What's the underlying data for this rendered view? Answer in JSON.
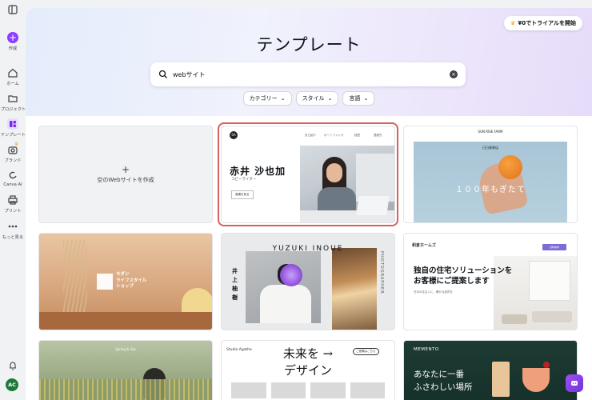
{
  "sidebar": {
    "items": [
      {
        "label": "作成",
        "icon": "plus-icon"
      },
      {
        "label": "ホーム",
        "icon": "home-icon"
      },
      {
        "label": "プロジェクト",
        "icon": "folder-icon"
      },
      {
        "label": "テンプレート",
        "icon": "templates-icon"
      },
      {
        "label": "ブランド",
        "icon": "brand-icon"
      },
      {
        "label": "Canva AI",
        "icon": "canva-ai-icon"
      },
      {
        "label": "プリント",
        "icon": "print-icon"
      },
      {
        "label": "もっと見る",
        "icon": "more-icon"
      }
    ],
    "avatar_initials": "AC"
  },
  "header": {
    "trial_button": "¥0でトライアルを開始",
    "title": "テンプレート"
  },
  "search": {
    "value": "webサイト"
  },
  "filters": [
    "カテゴリー",
    "スタイル",
    "言語"
  ],
  "create_card": {
    "plus": "+",
    "label": "空のWebサイトを作成"
  },
  "templates": {
    "akai": {
      "logo": "SA",
      "nav": [
        "自己紹介",
        "ポートフォリオ",
        "経歴",
        "連絡先"
      ],
      "name": "赤井 沙也加",
      "job": "コピーライター",
      "cta": "実績を見る"
    },
    "orange": {
      "brand_top": "SUN RISE FARM",
      "brand_name": "日日青果店",
      "caption": "１００年もぎたて"
    },
    "lifestyle": {
      "line1": "モダン",
      "line2": "ライフスタイル",
      "line3": "ショップ"
    },
    "yuzuki": {
      "heading": "YUZUKI INOUE",
      "vertical": "井上柚樹",
      "side": "PHOTOGRAPHER"
    },
    "homes": {
      "logo": "和倉ホームズ",
      "button": "資料請求",
      "headline1": "独自の住宅ソリューションを",
      "headline2": "お客様にご提案します",
      "small": "日本の住まいに、確かな品質を"
    },
    "spring": {
      "signature": "Spring & Sky"
    },
    "studio": {
      "logo": "Studio Agathe",
      "button": "ご依頼はこちら",
      "headline1": "未来を →",
      "headline2": "デザイン"
    },
    "memento": {
      "logo": "MEMENTO",
      "headline1": "あなたに一番",
      "headline2": "ふさわしい場所"
    }
  },
  "colors": {
    "accent": "#8b3dff",
    "selected_outline": "#d8605f",
    "avatar": "#1d7a3b"
  }
}
